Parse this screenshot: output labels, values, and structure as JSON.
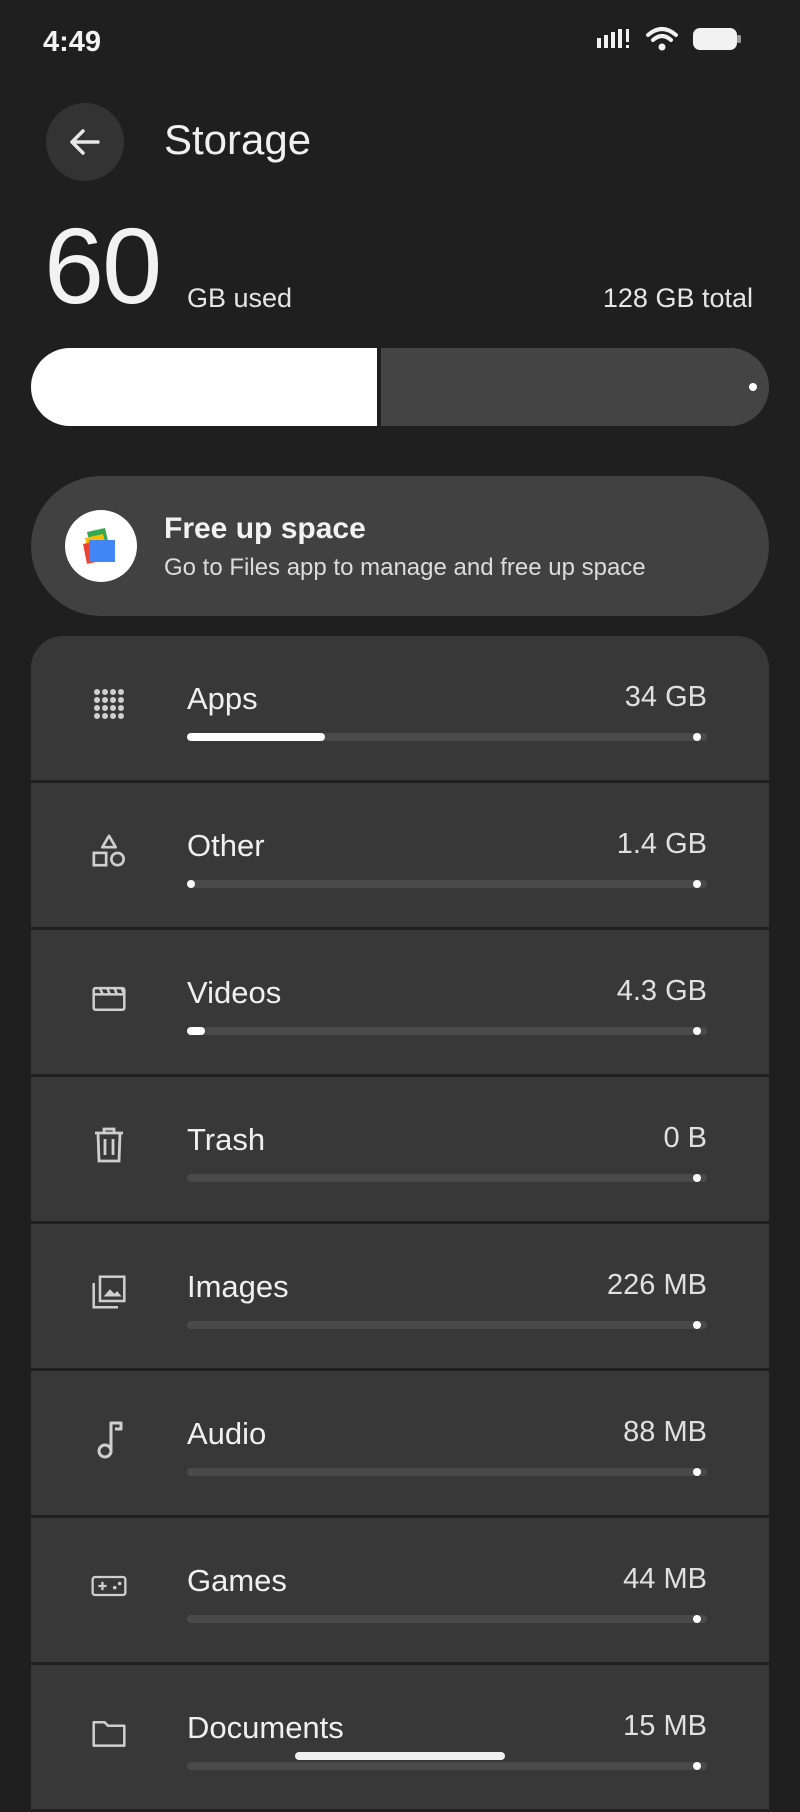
{
  "status_bar": {
    "time": "4:49",
    "battery_level": 0.9
  },
  "header": {
    "title": "Storage",
    "back_icon": "arrow-left-icon"
  },
  "summary": {
    "used_value": "60",
    "used_label": "GB used",
    "total_label": "128 GB total",
    "used_fraction": 0.469
  },
  "free_up": {
    "title": "Free up space",
    "subtitle": "Go to Files app to manage and free up space",
    "icon": "files-app-icon"
  },
  "categories": [
    {
      "name": "Apps",
      "size": "34 GB",
      "icon": "apps-grid-icon",
      "fraction": 0.266
    },
    {
      "name": "Other",
      "size": "1.4 GB",
      "icon": "shapes-icon",
      "fraction": 0.011
    },
    {
      "name": "Videos",
      "size": "4.3 GB",
      "icon": "clapperboard-icon",
      "fraction": 0.034
    },
    {
      "name": "Trash",
      "size": "0 B",
      "icon": "trash-icon",
      "fraction": 0
    },
    {
      "name": "Images",
      "size": "226 MB",
      "icon": "image-stack-icon",
      "fraction": 0
    },
    {
      "name": "Audio",
      "size": "88 MB",
      "icon": "music-note-icon",
      "fraction": 0
    },
    {
      "name": "Games",
      "size": "44 MB",
      "icon": "gamepad-icon",
      "fraction": 0
    },
    {
      "name": "Documents",
      "size": "15 MB",
      "icon": "folder-icon",
      "fraction": 0
    }
  ],
  "colors": {
    "background": "#1f1f1f",
    "card": "#383838",
    "accent": "#ffffff"
  }
}
